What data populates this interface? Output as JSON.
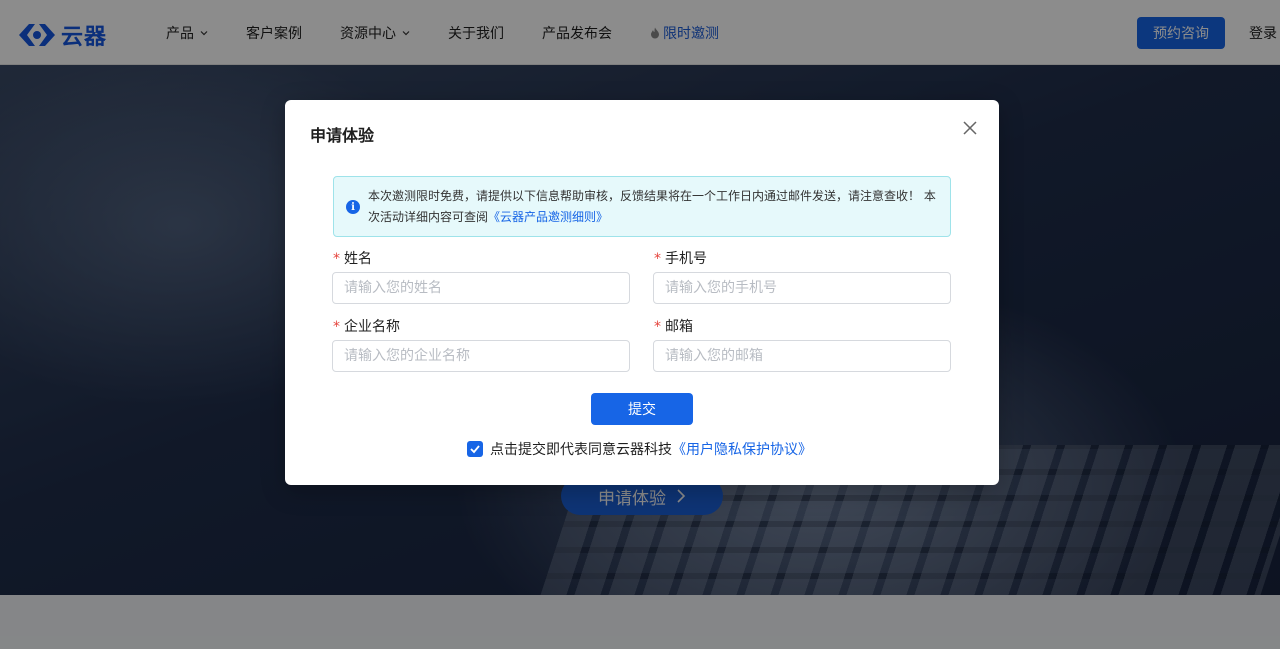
{
  "nav": {
    "logo_text": "云器",
    "items": [
      {
        "label": "产品",
        "has_dropdown": true
      },
      {
        "label": "客户案例",
        "has_dropdown": false
      },
      {
        "label": "资源中心",
        "has_dropdown": true
      },
      {
        "label": "关于我们",
        "has_dropdown": false
      },
      {
        "label": "产品发布会",
        "has_dropdown": false
      },
      {
        "label": "限时邀测",
        "has_dropdown": false,
        "icon": "fire-icon"
      }
    ],
    "appoint_label": "预约咨询",
    "login_label": "登录"
  },
  "hero": {
    "cta_label": "申请体验"
  },
  "modal": {
    "title": "申请体验",
    "notice_text": "本次邀测限时免费，请提供以下信息帮助审核，反馈结果将在一个工作日内通过邮件发送，请注意查收！ 本次活动详细内容可查阅",
    "notice_link": "《云器产品邀测细则》",
    "fields": {
      "name": {
        "label": "姓名",
        "placeholder": "请输入您的姓名"
      },
      "phone": {
        "label": "手机号",
        "placeholder": "请输入您的手机号"
      },
      "company": {
        "label": "企业名称",
        "placeholder": "请输入您的企业名称"
      },
      "email": {
        "label": "邮箱",
        "placeholder": "请输入您的邮箱"
      }
    },
    "required_mark": "*",
    "submit_label": "提交",
    "agree_text": "点击提交即代表同意云器科技",
    "agree_link": "《用户隐私保护协议》",
    "agree_checked": true
  },
  "colors": {
    "brand": "#1765e6",
    "required": "#e5433c",
    "notice_bg": "#e6f9fb",
    "notice_border": "#9ee3ea"
  }
}
